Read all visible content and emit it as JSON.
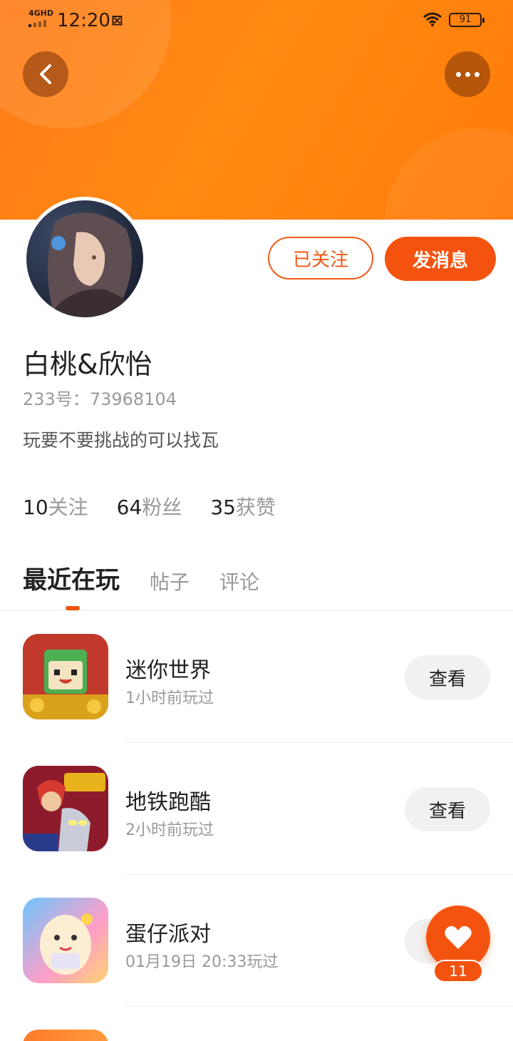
{
  "status_bar": {
    "network": "4GHD",
    "time": "12:20",
    "battery": "91"
  },
  "header": {
    "back_icon": "chevron-left-icon",
    "more_icon": "more-dots-icon"
  },
  "profile": {
    "name": "白桃&欣怡",
    "id_label": "233号：",
    "id_value": "73968104",
    "bio": "玩要不要挑战的可以找瓦",
    "followed_label": "已关注",
    "message_label": "发消息"
  },
  "stats": [
    {
      "num": "10",
      "label": "关注"
    },
    {
      "num": "64",
      "label": "粉丝"
    },
    {
      "num": "35",
      "label": "获赞"
    }
  ],
  "tabs": [
    {
      "label": "最近在玩",
      "active": true
    },
    {
      "label": "帖子",
      "active": false
    },
    {
      "label": "评论",
      "active": false
    }
  ],
  "games": [
    {
      "name": "迷你世界",
      "time": "1小时前玩过",
      "action": "查看"
    },
    {
      "name": "地铁跑酷",
      "time": "2小时前玩过",
      "action": "查看"
    },
    {
      "name": "蛋仔派对",
      "time": "01月19日 20:33玩过",
      "action": "查看"
    }
  ],
  "like_fab": {
    "icon": "heart-icon",
    "count": "11"
  },
  "colors": {
    "accent": "#f4530f",
    "banner": "#ff8212"
  }
}
